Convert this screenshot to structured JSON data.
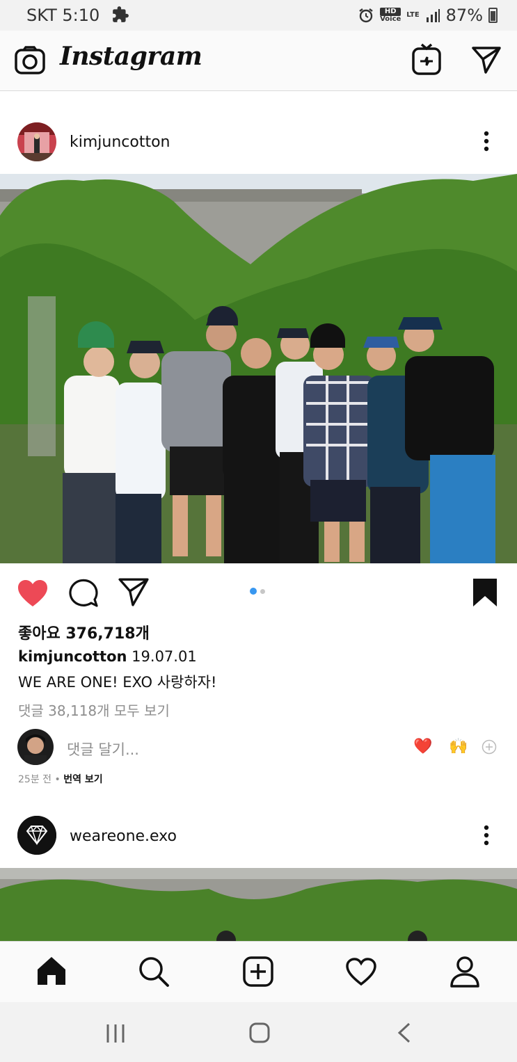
{
  "status_bar": {
    "carrier": "SKT 5:10",
    "battery": "87%",
    "network_hd": "HD",
    "network_voice": "Voice",
    "network_lte": "LTE"
  },
  "app": {
    "title": "Instagram"
  },
  "posts": [
    {
      "username": "kimjuncotton",
      "slide_count": 2,
      "active_slide": 1,
      "likes": "좋아요 376,718개",
      "caption_date": "19.07.01",
      "caption": "WE ARE ONE! EXO 사랑하자!",
      "view_comments": "댓글 38,118개 모두 보기",
      "add_comment_placeholder": "댓글 달기...",
      "reaction_1": "❤️",
      "reaction_2": "🙌",
      "time_ago": "25분 전",
      "translate": "번역 보기"
    },
    {
      "username": "weareone.exo"
    }
  ],
  "colors": {
    "liked_heart": "#ed4956",
    "slide_active": "#3897f0",
    "slide_inactive": "#c7c7c7"
  }
}
